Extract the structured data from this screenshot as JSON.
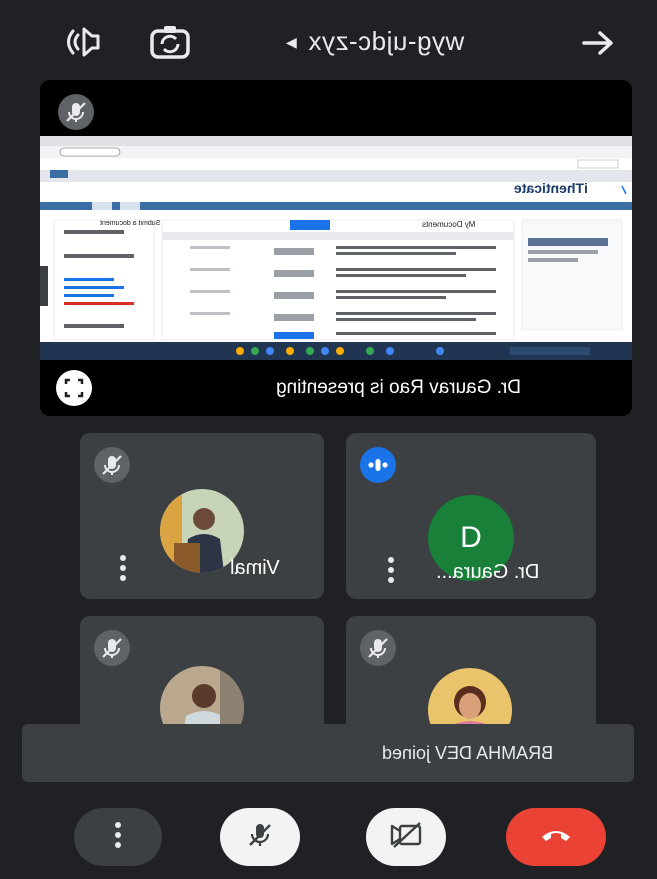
{
  "header": {
    "meeting_code": "wyg-ujdc-zyx",
    "icons": [
      "audio-output-icon",
      "switch-camera-icon",
      "chevron-icon",
      "share-arrow-icon"
    ]
  },
  "presentation": {
    "label": "Dr. Gaurav Rao is presenting",
    "shared_app_title": "iThenticate",
    "shared_folder_title": "My Documents",
    "shared_submit_label": "Submit a document"
  },
  "participants": [
    {
      "name": "Vimal",
      "muted": true,
      "avatar": "photo"
    },
    {
      "name": "Dr. Gaura...",
      "muted": false,
      "speaking": true,
      "avatar_letter": "D",
      "avatar_color": "#188038"
    },
    {
      "name": "",
      "muted": true,
      "avatar": "photo"
    },
    {
      "name": "",
      "muted": true,
      "avatar": "photo"
    }
  ],
  "toast": {
    "text": "BRAMHA DEV joined"
  },
  "controls": {
    "more": "more-options-icon",
    "mic": "mic-off-icon",
    "camera": "camera-off-icon",
    "leave": "end-call-icon"
  },
  "colors": {
    "background": "#202124",
    "tile": "#3c4043",
    "leave": "#ea4335",
    "speaking": "#1a73e8"
  }
}
